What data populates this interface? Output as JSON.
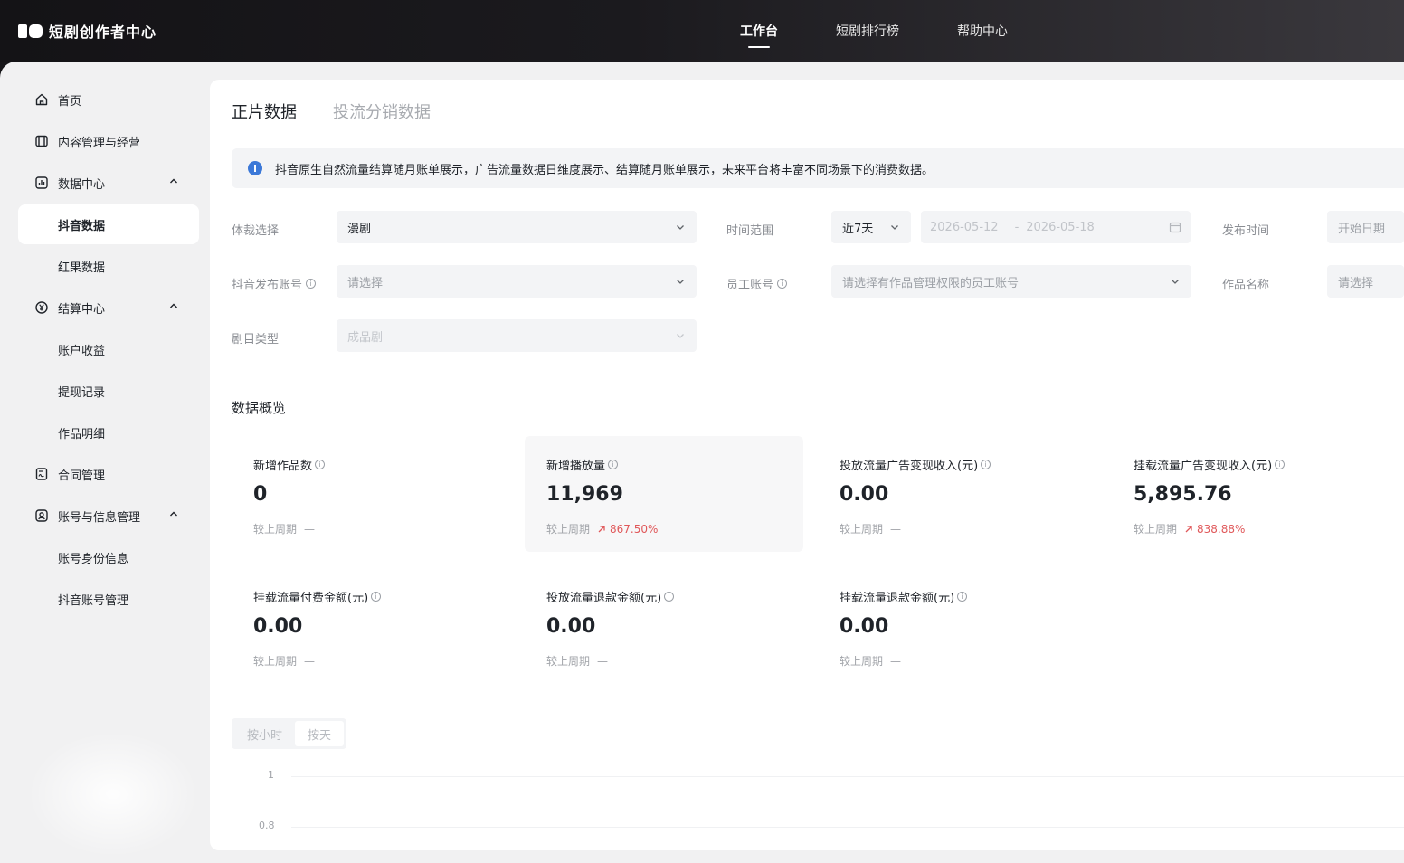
{
  "brand": {
    "name": "短剧创作者中心"
  },
  "top_nav": [
    {
      "label": "工作台",
      "active": true
    },
    {
      "label": "短剧排行榜",
      "active": false
    },
    {
      "label": "帮助中心",
      "active": false
    }
  ],
  "sidebar": {
    "items": [
      {
        "label": "首页",
        "icon": "home-icon"
      },
      {
        "label": "内容管理与经营",
        "icon": "film-icon"
      },
      {
        "label": "数据中心",
        "icon": "chart-icon",
        "expanded": true
      },
      {
        "label": "抖音数据",
        "sub": true,
        "active": true
      },
      {
        "label": "红果数据",
        "sub": true
      },
      {
        "label": "结算中心",
        "icon": "yuan-icon",
        "expanded": true
      },
      {
        "label": "账户收益",
        "sub": true
      },
      {
        "label": "提现记录",
        "sub": true
      },
      {
        "label": "作品明细",
        "sub": true
      },
      {
        "label": "合同管理",
        "icon": "contract-icon"
      },
      {
        "label": "账号与信息管理",
        "icon": "user-icon",
        "expanded": true
      },
      {
        "label": "账号身份信息",
        "sub": true
      },
      {
        "label": "抖音账号管理",
        "sub": true
      }
    ]
  },
  "tabs": [
    {
      "label": "正片数据",
      "active": true
    },
    {
      "label": "投流分销数据",
      "active": false
    }
  ],
  "notice": {
    "text": "抖音原生自然流量结算随月账单展示，广告流量数据日维度展示、结算随月账单展示，未来平台将丰富不同场景下的消费数据。"
  },
  "filters": {
    "genre": {
      "label": "体裁选择",
      "value": "漫剧"
    },
    "time_range": {
      "label": "时间范围",
      "value": "近7天",
      "start": "2026-05-12",
      "sep": "-",
      "end": "2026-05-18"
    },
    "publish_time": {
      "label": "发布时间",
      "placeholder": "开始日期"
    },
    "douyin_account": {
      "label": "抖音发布账号",
      "placeholder": "请选择"
    },
    "staff_account": {
      "label": "员工账号",
      "placeholder": "请选择有作品管理权限的员工账号"
    },
    "work_name": {
      "label": "作品名称",
      "placeholder": "请选择"
    },
    "drama_type": {
      "label": "剧目类型",
      "value": "成品剧"
    }
  },
  "overview": {
    "title": "数据概览",
    "compare_label": "较上周期",
    "cards": [
      {
        "title": "新增作品数",
        "value": "0",
        "change": "—",
        "up": false
      },
      {
        "title": "新增播放量",
        "value": "11,969",
        "change": "867.50%",
        "up": true
      },
      {
        "title": "投放流量广告变现收入(元)",
        "value": "0.00",
        "change": "—",
        "up": false
      },
      {
        "title": "挂载流量广告变现收入(元)",
        "value": "5,895.76",
        "change": "838.88%",
        "up": true
      },
      {
        "title": "挂载流量付费金额(元)",
        "value": "0.00",
        "change": "—",
        "up": false
      },
      {
        "title": "投放流量退款金额(元)",
        "value": "0.00",
        "change": "—",
        "up": false
      },
      {
        "title": "挂载流量退款金额(元)",
        "value": "0.00",
        "change": "—",
        "up": false
      }
    ]
  },
  "granularity": {
    "options": [
      "按小时",
      "按天"
    ],
    "selected": "按天"
  },
  "chart": {
    "y_ticks": [
      "1",
      "0.8"
    ]
  },
  "colors": {
    "accent_info": "#3b78d8",
    "increase": "#e0585a"
  }
}
